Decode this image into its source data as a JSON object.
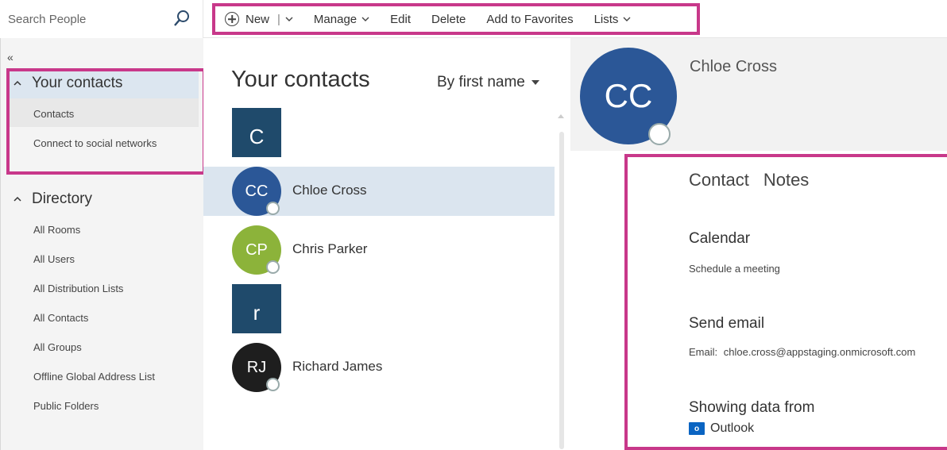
{
  "search": {
    "placeholder": "Search People"
  },
  "commands": {
    "new_label": "New",
    "manage_label": "Manage",
    "edit_label": "Edit",
    "delete_label": "Delete",
    "favorites_label": "Add to Favorites",
    "lists_label": "Lists"
  },
  "leftnav": {
    "collapse_glyph": "«",
    "your_contacts": {
      "header": "Your contacts",
      "items": [
        "Contacts",
        "Connect to social networks"
      ]
    },
    "directory": {
      "header": "Directory",
      "items": [
        "All Rooms",
        "All Users",
        "All Distribution Lists",
        "All Contacts",
        "All Groups",
        "Offline Global Address List",
        "Public Folders"
      ]
    }
  },
  "list": {
    "title": "Your contacts",
    "sort_label": "By first name",
    "groups": [
      {
        "letter": "C",
        "contacts": [
          {
            "initials": "CC",
            "name": "Chloe Cross",
            "color": "#2b5797",
            "selected": true
          },
          {
            "initials": "CP",
            "name": "Chris Parker",
            "color": "#8cb33a",
            "selected": false
          }
        ]
      },
      {
        "letter": "r",
        "contacts": [
          {
            "initials": "RJ",
            "name": "Richard James",
            "color": "#1e1e1e",
            "selected": false
          }
        ]
      }
    ]
  },
  "detail": {
    "initials": "CC",
    "name": "Chloe Cross",
    "tabs": [
      "Contact",
      "Notes"
    ],
    "calendar_title": "Calendar",
    "calendar_action": "Schedule a meeting",
    "email_title": "Send email",
    "email_label": "Email:",
    "email_value": "chloe.cross@appstaging.onmicrosoft.com",
    "source_title": "Showing data from",
    "source_icon_text": "o",
    "source_name": "Outlook"
  },
  "colors": {
    "highlight": "#c8388a",
    "tile": "#1f4a6b",
    "selected_row": "#dbe5ef"
  }
}
